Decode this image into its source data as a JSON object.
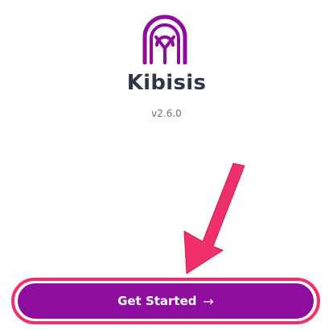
{
  "app": {
    "name": "Kibisis",
    "version": "v2.6.0",
    "logo_icon": "kibisis-logo-icon"
  },
  "actions": {
    "get_started_label": "Get Started",
    "get_started_arrow": "→"
  },
  "colors": {
    "brand_purple": "#8e0d9e",
    "annotation_pink": "#f0306a",
    "title_text": "#2d3748",
    "muted_text": "#6b7280"
  }
}
